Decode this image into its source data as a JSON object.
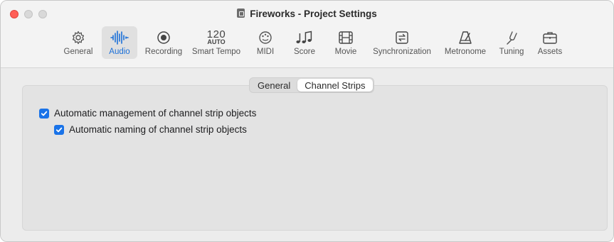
{
  "window": {
    "title": "Fireworks - Project Settings"
  },
  "toolbar": {
    "items": [
      {
        "label": "General",
        "icon": "gear-icon"
      },
      {
        "label": "Audio",
        "icon": "waveform-icon",
        "active": true
      },
      {
        "label": "Recording",
        "icon": "record-icon"
      },
      {
        "label": "Smart Tempo",
        "icon": "tempo-icon",
        "tempo_value": "120",
        "tempo_mode": "AUTO"
      },
      {
        "label": "MIDI",
        "icon": "midi-palette-icon"
      },
      {
        "label": "Score",
        "icon": "music-notes-icon"
      },
      {
        "label": "Movie",
        "icon": "film-icon"
      },
      {
        "label": "Synchronization",
        "icon": "sync-icon"
      },
      {
        "label": "Metronome",
        "icon": "metronome-icon"
      },
      {
        "label": "Tuning",
        "icon": "tuning-fork-icon"
      },
      {
        "label": "Assets",
        "icon": "briefcase-icon"
      }
    ],
    "accent_color": "#1a6fd8"
  },
  "tabs": {
    "items": [
      {
        "label": "General",
        "selected": false
      },
      {
        "label": "Channel Strips",
        "selected": true
      }
    ]
  },
  "settings": {
    "auto_management": {
      "label": "Automatic management of channel strip objects",
      "checked": true
    },
    "auto_naming": {
      "label": "Automatic naming of channel strip objects",
      "checked": true
    }
  },
  "colors": {
    "checkbox": "#1a73e8",
    "close_button": "#ff5f57"
  }
}
